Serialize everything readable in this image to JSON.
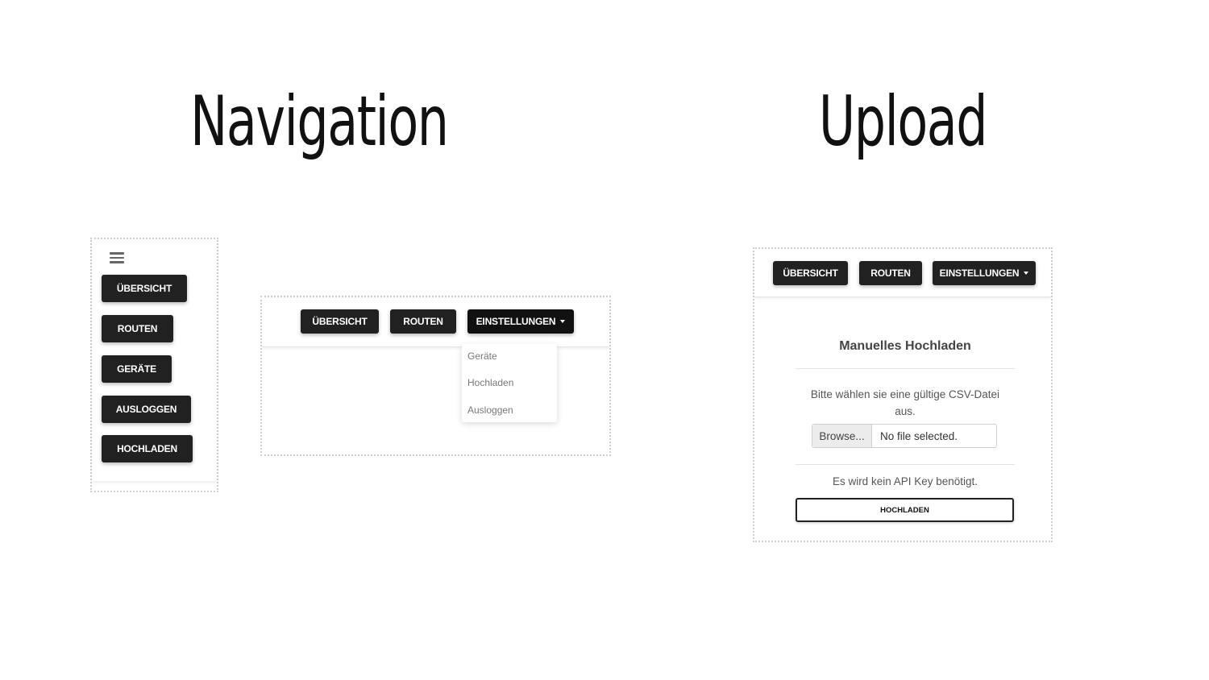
{
  "titles": {
    "navigation": "Navigation",
    "upload": "Upload"
  },
  "mobile_menu": {
    "icon": "hamburger-icon",
    "items": [
      "ÜBERSICHT",
      "ROUTEN",
      "GERÄTE",
      "AUSLOGGEN",
      "HOCHLADEN"
    ]
  },
  "desktop_nav": {
    "buttons": [
      "ÜBERSICHT",
      "ROUTEN",
      "EINSTELLUNGEN"
    ],
    "dropdown_icon": "caret-down-icon",
    "dropdown_items": [
      "Geräte",
      "Hochladen",
      "Ausloggen"
    ]
  },
  "upload_page": {
    "nav_buttons": [
      "ÜBERSICHT",
      "ROUTEN",
      "EINSTELLUNGEN"
    ],
    "card": {
      "title": "Manuelles Hochladen",
      "instruction": "Bitte wählen sie eine gültige CSV-Datei aus.",
      "browse_label": "Browse...",
      "file_status": "No file selected.",
      "api_note": "Es wird kein API Key benötigt.",
      "submit_label": "HOCHLADEN"
    }
  },
  "colors": {
    "button_bg": "#212121",
    "button_text": "#ffffff",
    "border_dotted": "#cfcfcf"
  }
}
